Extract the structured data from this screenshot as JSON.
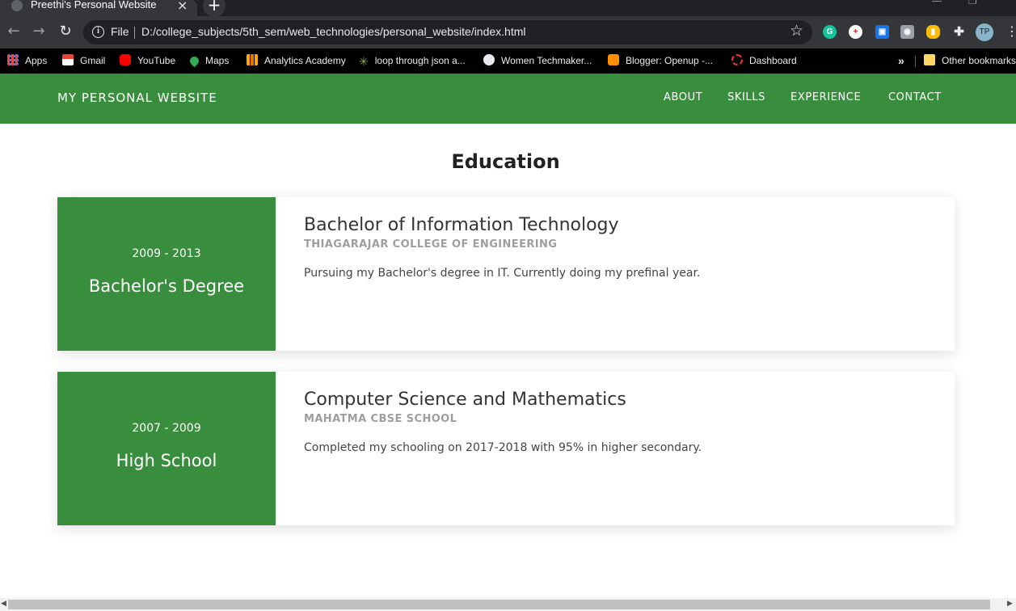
{
  "browser": {
    "tab_title": "Preethi's Personal Website",
    "tab_close": "×",
    "new_tab": "+",
    "scheme_label": "File",
    "url": "D:/college_subjects/5th_sem/web_technologies/personal_website/index.html",
    "profile_initials": "TP",
    "bookmarks": [
      {
        "label": "Apps",
        "icon": "apps-grid-icon",
        "color": "#e8453c"
      },
      {
        "label": "Gmail",
        "icon": "gmail-icon",
        "color": "#ea4335"
      },
      {
        "label": "YouTube",
        "icon": "youtube-icon",
        "color": "#ff0000"
      },
      {
        "label": "Maps",
        "icon": "maps-pin-icon",
        "color": "#34a853"
      },
      {
        "label": "Analytics Academy",
        "icon": "analytics-icon",
        "color": "#f9ab00"
      },
      {
        "label": "loop through json a...",
        "icon": "star-burst-icon",
        "color": "#7cb342"
      },
      {
        "label": "Women Techmaker...",
        "icon": "globe-icon",
        "color": "#e8eaed"
      },
      {
        "label": "Blogger: Openup -...",
        "icon": "blogger-icon",
        "color": "#ff8f00"
      },
      {
        "label": "Dashboard",
        "icon": "dashboard-ring-icon",
        "color": "#e53935"
      }
    ],
    "bookmarks_overflow": "»",
    "other_bookmarks": "Other bookmarks"
  },
  "site": {
    "brand": "MY PERSONAL WEBSITE",
    "nav": [
      "ABOUT",
      "SKILLS",
      "EXPERIENCE",
      "CONTACT"
    ],
    "accent_color": "#388e3c"
  },
  "education": {
    "title": "Education",
    "entries": [
      {
        "years": "2009 - 2013",
        "level": "Bachelor's Degree",
        "course": "Bachelor of Information Technology",
        "institution": "THIAGARAJAR COLLEGE OF ENGINEERING",
        "description": "Pursuing my Bachelor's degree in IT. Currently doing my prefinal year."
      },
      {
        "years": "2007 - 2009",
        "level": "High School",
        "course": "Computer Science and Mathematics",
        "institution": "MAHATMA CBSE SCHOOL",
        "description": "Completed my schooling on 2017-2018 with 95% in higher secondary."
      }
    ]
  }
}
